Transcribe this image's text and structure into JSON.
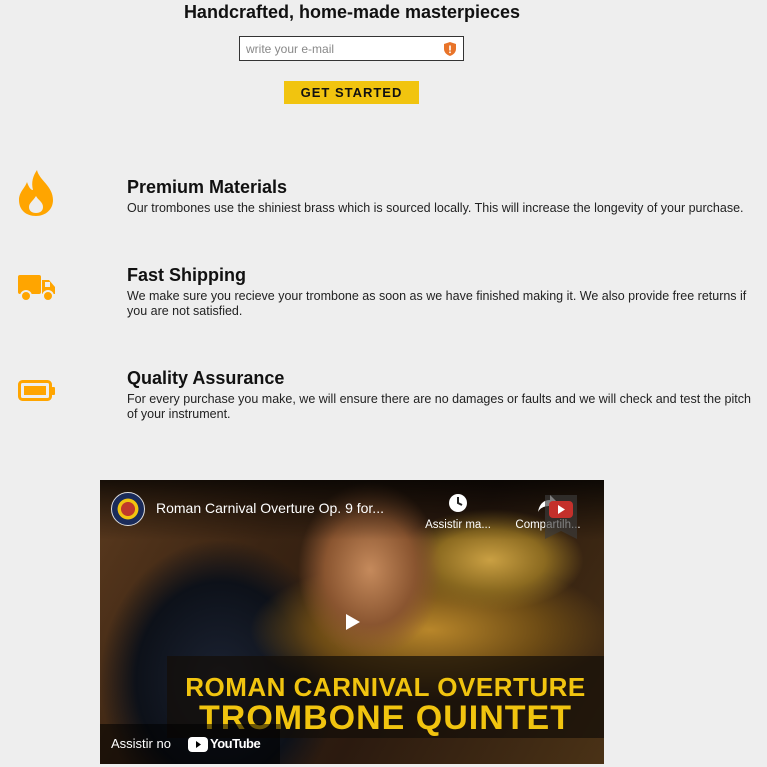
{
  "hero": {
    "title": "Handcrafted, home-made masterpieces",
    "email_placeholder": "write your e-mail",
    "cta_label": "GET STARTED"
  },
  "features": [
    {
      "icon": "fire-icon",
      "title": "Premium Materials",
      "description": "Our trombones use the shiniest brass which is sourced locally. This will increase the longevity of your purchase."
    },
    {
      "icon": "truck-icon",
      "title": "Fast Shipping",
      "description": "We make sure you recieve your trombone as soon as we have finished making it. We also provide free returns if you are not satisfied."
    },
    {
      "icon": "battery-icon",
      "title": "Quality Assurance",
      "description": "For every purchase you make, we will ensure there are no damages or faults and we will check and test the pitch of your instrument."
    }
  ],
  "video": {
    "title": "Roman Carnival Overture Op. 9 for...",
    "watch_later_label": "Assistir ma...",
    "share_label": "Compartilh...",
    "overlay_line1": "ROMAN CARNIVAL OVERTURE",
    "overlay_line2": "TROMBONE QUINTET",
    "watch_on_label": "Assistir no",
    "youtube_label": "YouTube"
  },
  "colors": {
    "accent": "#f1c40f",
    "icon_orange": "#ffa500",
    "background": "#eeeeee"
  }
}
